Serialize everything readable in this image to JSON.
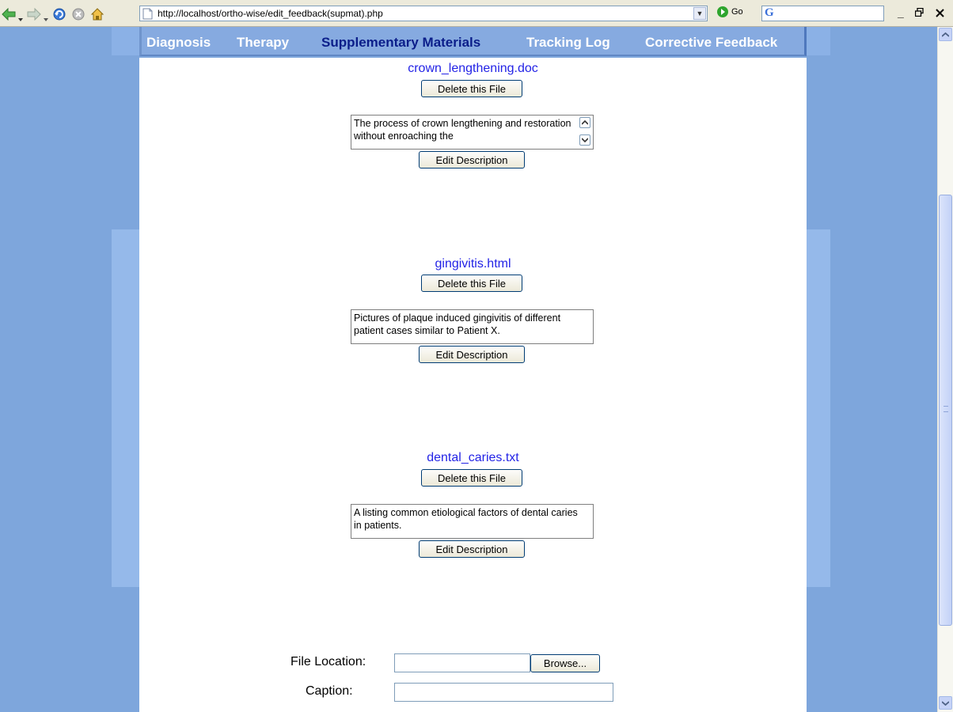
{
  "browser": {
    "url": "http://localhost/ortho-wise/edit_feedback(supmat).php",
    "go_label": "Go",
    "window_controls": {
      "minimize": "_",
      "restore": "🗗",
      "close": "×"
    },
    "icons": [
      "back-icon",
      "forward-icon",
      "refresh-icon",
      "stop-icon",
      "home-icon",
      "page-icon",
      "google-icon"
    ]
  },
  "nav": {
    "items": [
      {
        "label": "Diagnosis"
      },
      {
        "label": "Therapy"
      },
      {
        "label": "Supplementary Materials",
        "active": true
      },
      {
        "label": "Tracking Log"
      },
      {
        "label": "Corrective Feedback"
      }
    ]
  },
  "files": [
    {
      "name": "crown_lengthening.doc",
      "delete_label": "Delete this File",
      "description": "The process of crown lengthening and restoration without enroaching the",
      "edit_label": "Edit Description"
    },
    {
      "name": "gingivitis.html",
      "delete_label": "Delete this File",
      "description": "Pictures of plaque induced gingivitis of different patient cases similar to Patient X.",
      "edit_label": "Edit Description"
    },
    {
      "name": "dental_caries.txt",
      "delete_label": "Delete this File",
      "description": "A listing common etiological factors of dental caries in patients.",
      "edit_label": "Edit Description"
    }
  ],
  "upload_form": {
    "file_location_label": "File Location:",
    "browse_label": "Browse...",
    "file_location_value": "",
    "caption_label": "Caption:",
    "caption_value": ""
  },
  "colors": {
    "page_background": "#7ea6dc",
    "nav_background": "#86aae0",
    "nav_active_text": "#0b1e8a",
    "link": "#2323e6"
  }
}
